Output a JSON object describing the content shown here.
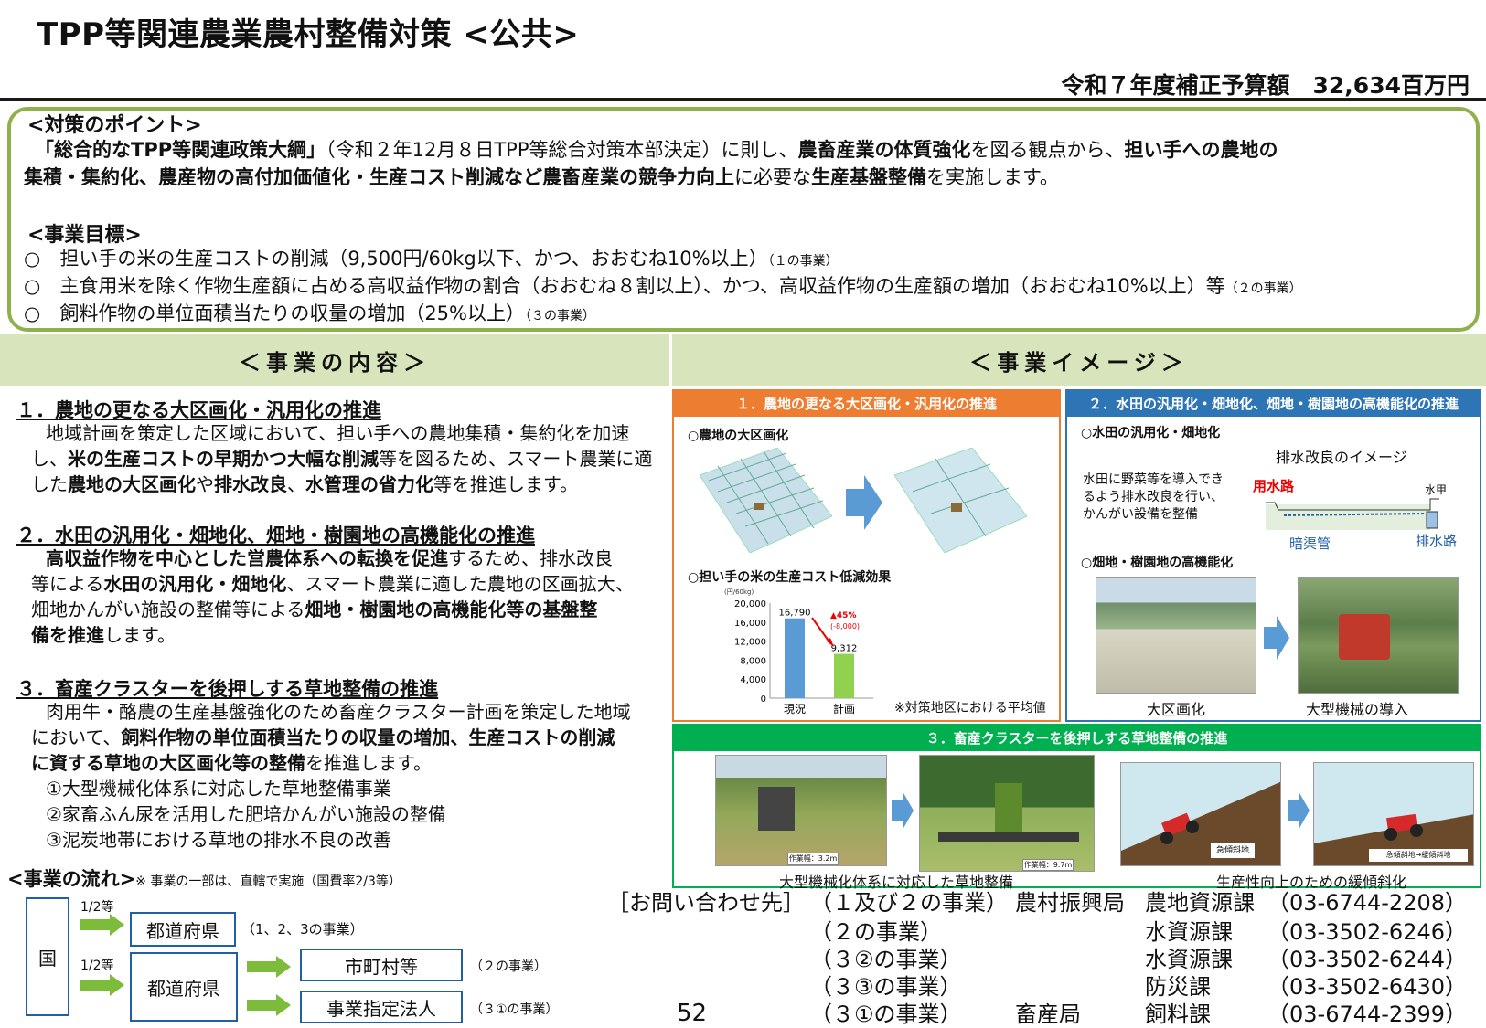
{
  "title": "TPP等関連農業農村整備対策 <公共>",
  "budget": "令和７年度補正予算額　32,634百万円",
  "points": {
    "heading": "<対策のポイント>",
    "line1_a": "「総合的なTPP等関連政策大綱」",
    "line1_b": "（令和２年12月８日TPP等総合対策本部決定）に則し、",
    "line1_c": "農畜産業の体質強化",
    "line1_d": "を図る観点から、",
    "line1_e": "担い手への農地の",
    "line2_a": "集積・集約化、農産物の高付加価値化・生産コスト削減など農畜産業の競争力向上",
    "line2_b": "に必要な",
    "line2_c": "生産基盤整備",
    "line2_d": "を実施します。",
    "goal_heading": "<事業目標>",
    "goals": [
      {
        "text": "○　担い手の米の生産コストの削減（9,500円/60kg以下、かつ、おおむね10%以上）",
        "note": "（１の事業）"
      },
      {
        "text": "○　主食用米を除く作物生産額に占める高収益作物の割合（おおむね８割以上）、かつ、高収益作物の生産額の増加（おおむね10%以上）等",
        "note": "（２の事業）"
      },
      {
        "text": "○　飼料作物の単位面積当たりの収量の増加（25%以上）",
        "note": "（３の事業）"
      }
    ]
  },
  "headers": {
    "content": "＜事業の内容＞",
    "image": "＜事業イメージ＞"
  },
  "content": {
    "s1_title": "１．農地の更なる大区画化・汎用化の推進",
    "s1_l1": "地域計画を策定した区域において、担い手への農地集積・集約化を加速",
    "s1_l2a": "し、",
    "s1_l2b": "米の生産コストの早期かつ大幅な削減",
    "s1_l2c": "等を図るため、スマート農業に適",
    "s1_l3a": "した",
    "s1_l3b": "農地の大区画化",
    "s1_l3c": "や",
    "s1_l3d": "排水改良",
    "s1_l3e": "、",
    "s1_l3f": "水管理の省力化",
    "s1_l3g": "等を推進します。",
    "s2_title": "２．水田の汎用化・畑地化、畑地・樹園地の高機能化の推進",
    "s2_l1a": "高収益作物を中心とした営農体系への転換を促進",
    "s2_l1b": "するため、排水改良",
    "s2_l2a": "等による",
    "s2_l2b": "水田の汎用化・畑地化",
    "s2_l2c": "、スマート農業に適した農地の区画拡大、",
    "s2_l3a": "畑地かんがい施設の整備等による",
    "s2_l3b": "畑地・樹園地の高機能化等の基盤整",
    "s2_l4a": "備を推進",
    "s2_l4b": "します。",
    "s3_title": "３．畜産クラスターを後押しする草地整備の推進",
    "s3_l1": "肉用牛・酪農の生産基盤強化のため畜産クラスター計画を策定した地域",
    "s3_l2a": "において、",
    "s3_l2b": "飼料作物の単位面積当たりの収量の増加、生産コストの削減",
    "s3_l3a": "に資する草地の大区画化等の整備",
    "s3_l3b": "を推進します。",
    "s3_items": [
      "①大型機械化体系に対応した草地整備事業",
      "②家畜ふん尿を活用した肥培かんがい施設の整備",
      "③泥炭地帯における草地の排水不良の改善"
    ]
  },
  "flow": {
    "heading": "<事業の流れ>",
    "note": "※ 事業の一部は、直轄で実施（国費率2/3等）",
    "country": "国",
    "rate1": "1/2等",
    "rate2": "1/2等",
    "pref1": "都道府県",
    "pref1_note": "（1、2、3の事業）",
    "pref2": "都道府県",
    "muni": "市町村等",
    "muni_note": "（２の事業）",
    "corp": "事業指定法人",
    "corp_note": "（３①の事業）"
  },
  "images": {
    "p1_header": "１．農地の更なる大区画化・汎用化の推進",
    "p1_label1": "○農地の大区画化",
    "p1_label2": "○担い手の米の生産コスト低減効果",
    "p1_note": "※対策地区における平均値",
    "p2_header": "２．水田の汎用化・畑地化、畑地・樹園地の高機能化の推進",
    "p2_label1": "○水田の汎用化・畑地化",
    "p2_drain_title": "排水改良のイメージ",
    "p2_desc": [
      "水田に野菜等を導入でき",
      "るよう排水改良を行い、",
      "かんがい設備を整備"
    ],
    "p2_water_in": "用水路",
    "p2_gate": "水甲",
    "p2_pipe": "暗渠管",
    "p2_drain": "排水路",
    "p2_label2": "○畑地・樹園地の高機能化",
    "p2_cap1": "大区画化",
    "p2_cap2": "大型機械の導入",
    "p3_header": "３．畜産クラスターを後押しする草地整備の推進",
    "p3_w1": "作業幅：3.2m",
    "p3_w2": "作業幅：9.7m",
    "p3_cap1": "大型機械化体系に対応した草地整備",
    "p3_slope1": "急傾斜地",
    "p3_slope2": "急傾斜地→緩傾斜地",
    "p3_cap2": "生産性向上のための緩傾斜化"
  },
  "chart_data": {
    "type": "bar",
    "categories": [
      "現況",
      "計画"
    ],
    "values": [
      16790,
      9312
    ],
    "value_labels": [
      "16,790",
      "9,312"
    ],
    "ylabel": "(円/60kg)",
    "yticks": [
      "20,000",
      "16,000",
      "12,000",
      "8,000",
      "4,000",
      "0"
    ],
    "ylim": [
      0,
      20000
    ],
    "annotation": "▲45%",
    "annotation2": "(-8,000)",
    "colors": [
      "#5b9bd5",
      "#92d050"
    ]
  },
  "contact": {
    "heading": "［お問い合わせ先］",
    "rows": [
      {
        "project": "（１及び２の事業）",
        "bureau": "農村振興局",
        "section": "農地資源課",
        "phone": "（03-6744-2208）"
      },
      {
        "project": "（２の事業）",
        "bureau": "",
        "section": "水資源課",
        "phone": "（03-3502-6246）"
      },
      {
        "project": "（３②の事業）",
        "bureau": "",
        "section": "水資源課",
        "phone": "（03-3502-6244）"
      },
      {
        "project": "（３③の事業）",
        "bureau": "",
        "section": "防災課",
        "phone": "（03-3502-6430）"
      },
      {
        "project": "（３①の事業）",
        "bureau": "畜産局",
        "section": "飼料課",
        "phone": "（03-6744-2399）"
      }
    ]
  },
  "page_number": "52"
}
